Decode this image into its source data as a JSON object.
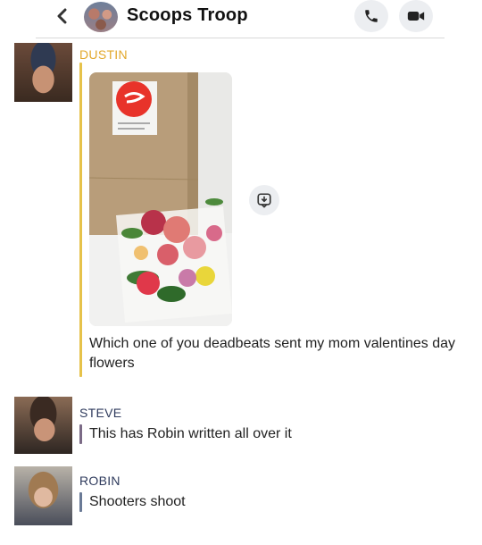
{
  "header": {
    "title": "Scoops Troop",
    "back_icon": "chevron-left-icon",
    "call_icon": "phone-icon",
    "video_icon": "video-camera-icon"
  },
  "messages": [
    {
      "sender": "DUSTIN",
      "sender_color": "#e2a82b",
      "has_photo": true,
      "photo_description_icon": "snap-photo",
      "save_icon": "save-to-chat-icon",
      "text": "Which one of you deadbeats sent my mom valentines day flowers"
    },
    {
      "sender": "STEVE",
      "sender_color": "#2e3a5c",
      "text": "This has Robin written all over it"
    },
    {
      "sender": "ROBIN",
      "sender_color": "#2e3a5c",
      "text": "Shooters shoot"
    }
  ],
  "colors": {
    "accent_dustin": "#e6c24a",
    "accent_steve": "#7b6a86",
    "accent_robin": "#6a7a96",
    "button_bg": "#eceef1",
    "doordash_red": "#e8332a"
  }
}
